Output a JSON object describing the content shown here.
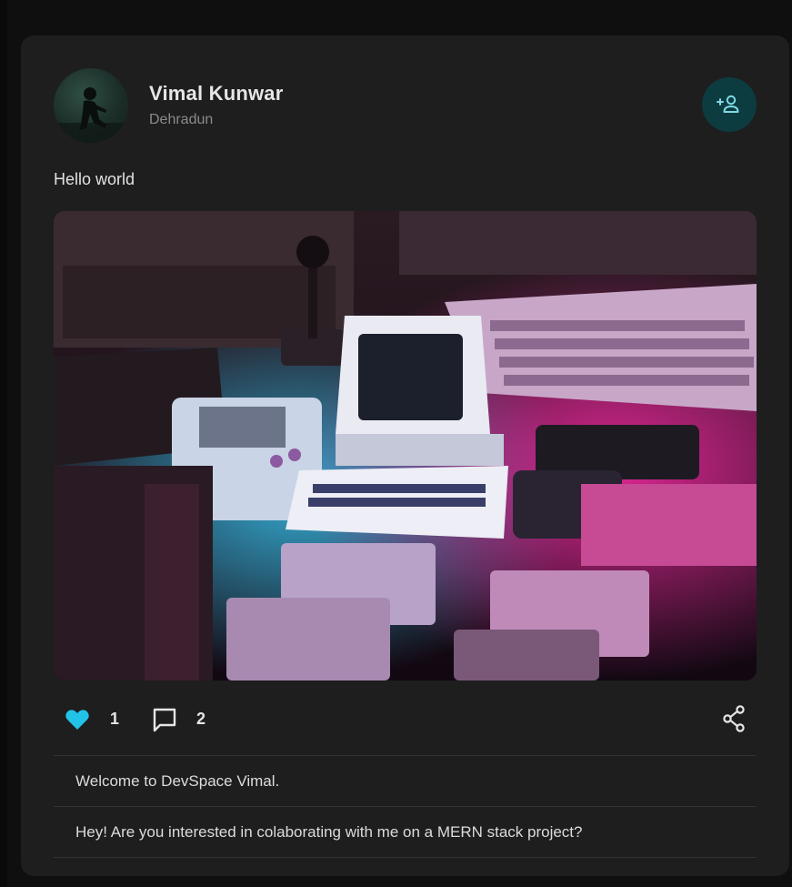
{
  "post": {
    "author": {
      "name": "Vimal Kunwar",
      "location": "Dehradun",
      "avatar_icon": "person-silhouette-avatar"
    },
    "add_friend_icon": "person-add-icon",
    "text": "Hello world",
    "image_alt_icon": "retro-computers-photo",
    "likes": {
      "count": "1",
      "icon": "heart-filled-icon",
      "color": "#22c3e8"
    },
    "comments_count": {
      "count": "2",
      "icon": "chat-bubble-icon"
    },
    "share_icon": "share-icon",
    "comments": [
      {
        "text": "Welcome to DevSpace Vimal."
      },
      {
        "text": "Hey! Are you interested in colaborating with me on a MERN stack project?"
      }
    ]
  },
  "colors": {
    "background": "#0f0f0f",
    "card": "#1e1e1e",
    "accent_button": "#0c3b40",
    "accent_icon": "#7fd9e4"
  }
}
